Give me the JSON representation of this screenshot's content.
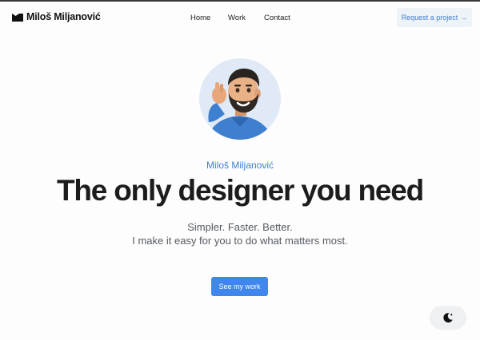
{
  "header": {
    "brand_name": "Miloš Miljanović",
    "nav": [
      "Home",
      "Work",
      "Contact"
    ],
    "cta_label": "Request a project",
    "cta_arrow": "→"
  },
  "hero": {
    "eyebrow": "Miloš Miljanović",
    "title": "The only designer you need",
    "subtitle_line1": "Simpler. Faster. Better.",
    "subtitle_line2": "I make it easy for you to do what matters most.",
    "button_label": "See my work"
  },
  "icons": {
    "brand": "logo-icon",
    "avatar": "memoji-avatar",
    "theme": "moon-stars-icon"
  },
  "colors": {
    "accent": "#3f86ee",
    "accent_text": "#3f7ed8",
    "cta_bg": "#eef3f8",
    "avatar_bg": "#dfeaf6"
  }
}
